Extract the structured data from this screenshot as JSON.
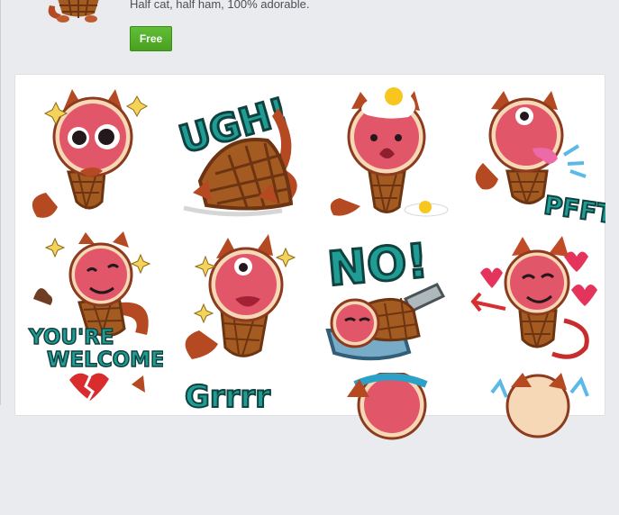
{
  "pack": {
    "tagline": "Half cat, half ham, 100% adorable.",
    "price_label": "Free"
  },
  "stickers": [
    {
      "icon": "starry-eyed-hamcat-sticker"
    },
    {
      "icon": "ugh-hamcat-sticker",
      "text": "UGH!"
    },
    {
      "icon": "egg-on-head-hamcat-sticker"
    },
    {
      "icon": "tongue-out-hamcat-sticker",
      "text": "PFFT!"
    },
    {
      "icon": "youre-welcome-hamcat-sticker",
      "text": "YOU'RE WELCOME!"
    },
    {
      "icon": "sparkling-happy-hamcat-sticker"
    },
    {
      "icon": "no-hamcat-sticker",
      "text": "NO!"
    },
    {
      "icon": "devil-hamcat-sticker"
    },
    {
      "icon": "broken-heart-hamcat-sticker"
    },
    {
      "icon": "grrr-hamcat-sticker",
      "text": "Grrrr"
    },
    {
      "icon": "headband-hamcat-sticker"
    },
    {
      "icon": "splash-hamcat-sticker"
    }
  ],
  "colors": {
    "ham": "#e2566a",
    "ham_light": "#f39a9d",
    "rind": "#f6d7b6",
    "fur": "#b54a22",
    "waffle": "#a45b21",
    "teal_text": "#1f9d94",
    "free_button": "#4fa82a"
  }
}
